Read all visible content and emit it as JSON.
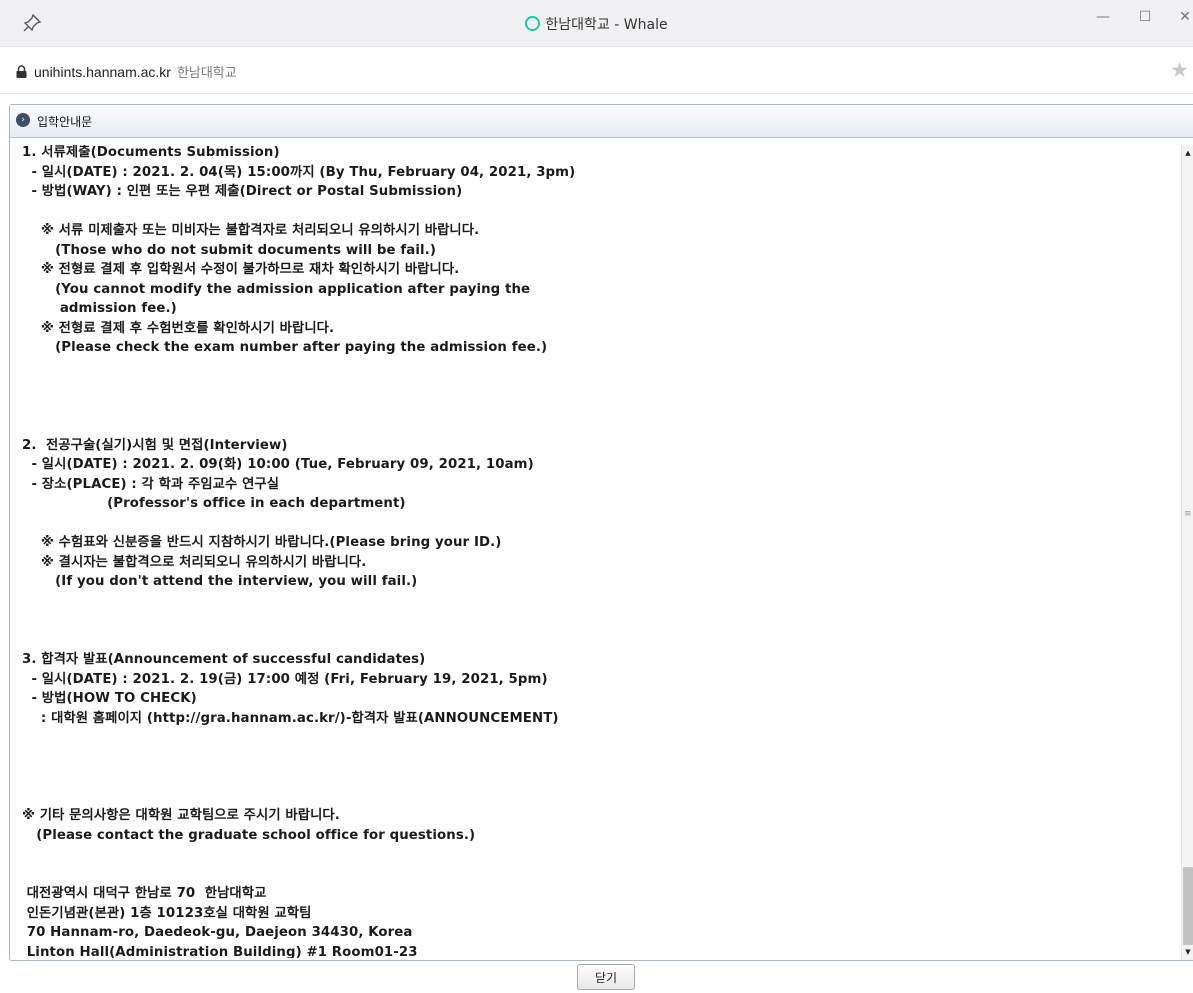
{
  "window": {
    "title": "한남대학교 - Whale",
    "minimize": "—",
    "maximize": "☐",
    "close": "✕"
  },
  "address": {
    "url": "unihints.hannam.ac.kr",
    "site_name": "한남대학교"
  },
  "panel": {
    "title": "입학안내문"
  },
  "content_lines": [
    "1. 서류제출(Documents Submission)",
    "  - 일시(DATE) : 2021. 2. 04(목) 15:00까지 (By Thu, February 04, 2021, 3pm)",
    "  - 방법(WAY) : 인편 또는 우편 제출(Direct or Postal Submission)",
    "",
    "    ※ 서류 미제출자 또는 미비자는 불합격자로 처리되오니 유의하시기 바랍니다.",
    "       (Those who do not submit documents will be fail.)",
    "    ※ 전형료 결제 후 입학원서 수정이 불가하므로 재차 확인하시기 바랍니다.",
    "       (You cannot modify the admission application after paying the",
    "        admission fee.)",
    "    ※ 전형료 결제 후 수험번호를 확인하시기 바랍니다.",
    "       (Please check the exam number after paying the admission fee.)",
    "",
    "",
    "",
    "",
    "2.  전공구술(실기)시험 및 면접(Interview)",
    "  - 일시(DATE) : 2021. 2. 09(화) 10:00 (Tue, February 09, 2021, 10am)",
    "  - 장소(PLACE) : 각 학과 주임교수 연구실",
    "                  (Professor's office in each department)",
    "",
    "    ※ 수험표와 신분증을 반드시 지참하시기 바랍니다.(Please bring your ID.)",
    "    ※ 결시자는 불합격으로 처리되오니 유의하시기 바랍니다.",
    "       (If you don't attend the interview, you will fail.)",
    "",
    "",
    "",
    "3. 합격자 발표(Announcement of successful candidates)",
    "  - 일시(DATE) : 2021. 2. 19(금) 17:00 예정 (Fri, February 19, 2021, 5pm)",
    "  - 방법(HOW TO CHECK)",
    "    : 대학원 홈페이지 (http://gra.hannam.ac.kr/)-합격자 발표(ANNOUNCEMENT)",
    "",
    "",
    "",
    "",
    "※ 기타 문의사항은 대학원 교학팀으로 주시기 바랍니다.",
    "   (Please contact the graduate school office for questions.)",
    "",
    "",
    " 대전광역시 대덕구 한남로 70  한남대학교",
    " 인돈기념관(본관) 1층 10123호실 대학원 교학팀",
    " 70 Hannam-ro, Daedeok-gu, Daejeon 34430, Korea",
    " Linton Hall(Administration Building) #1 Room01-23"
  ],
  "footer": {
    "close_label": "닫기"
  }
}
